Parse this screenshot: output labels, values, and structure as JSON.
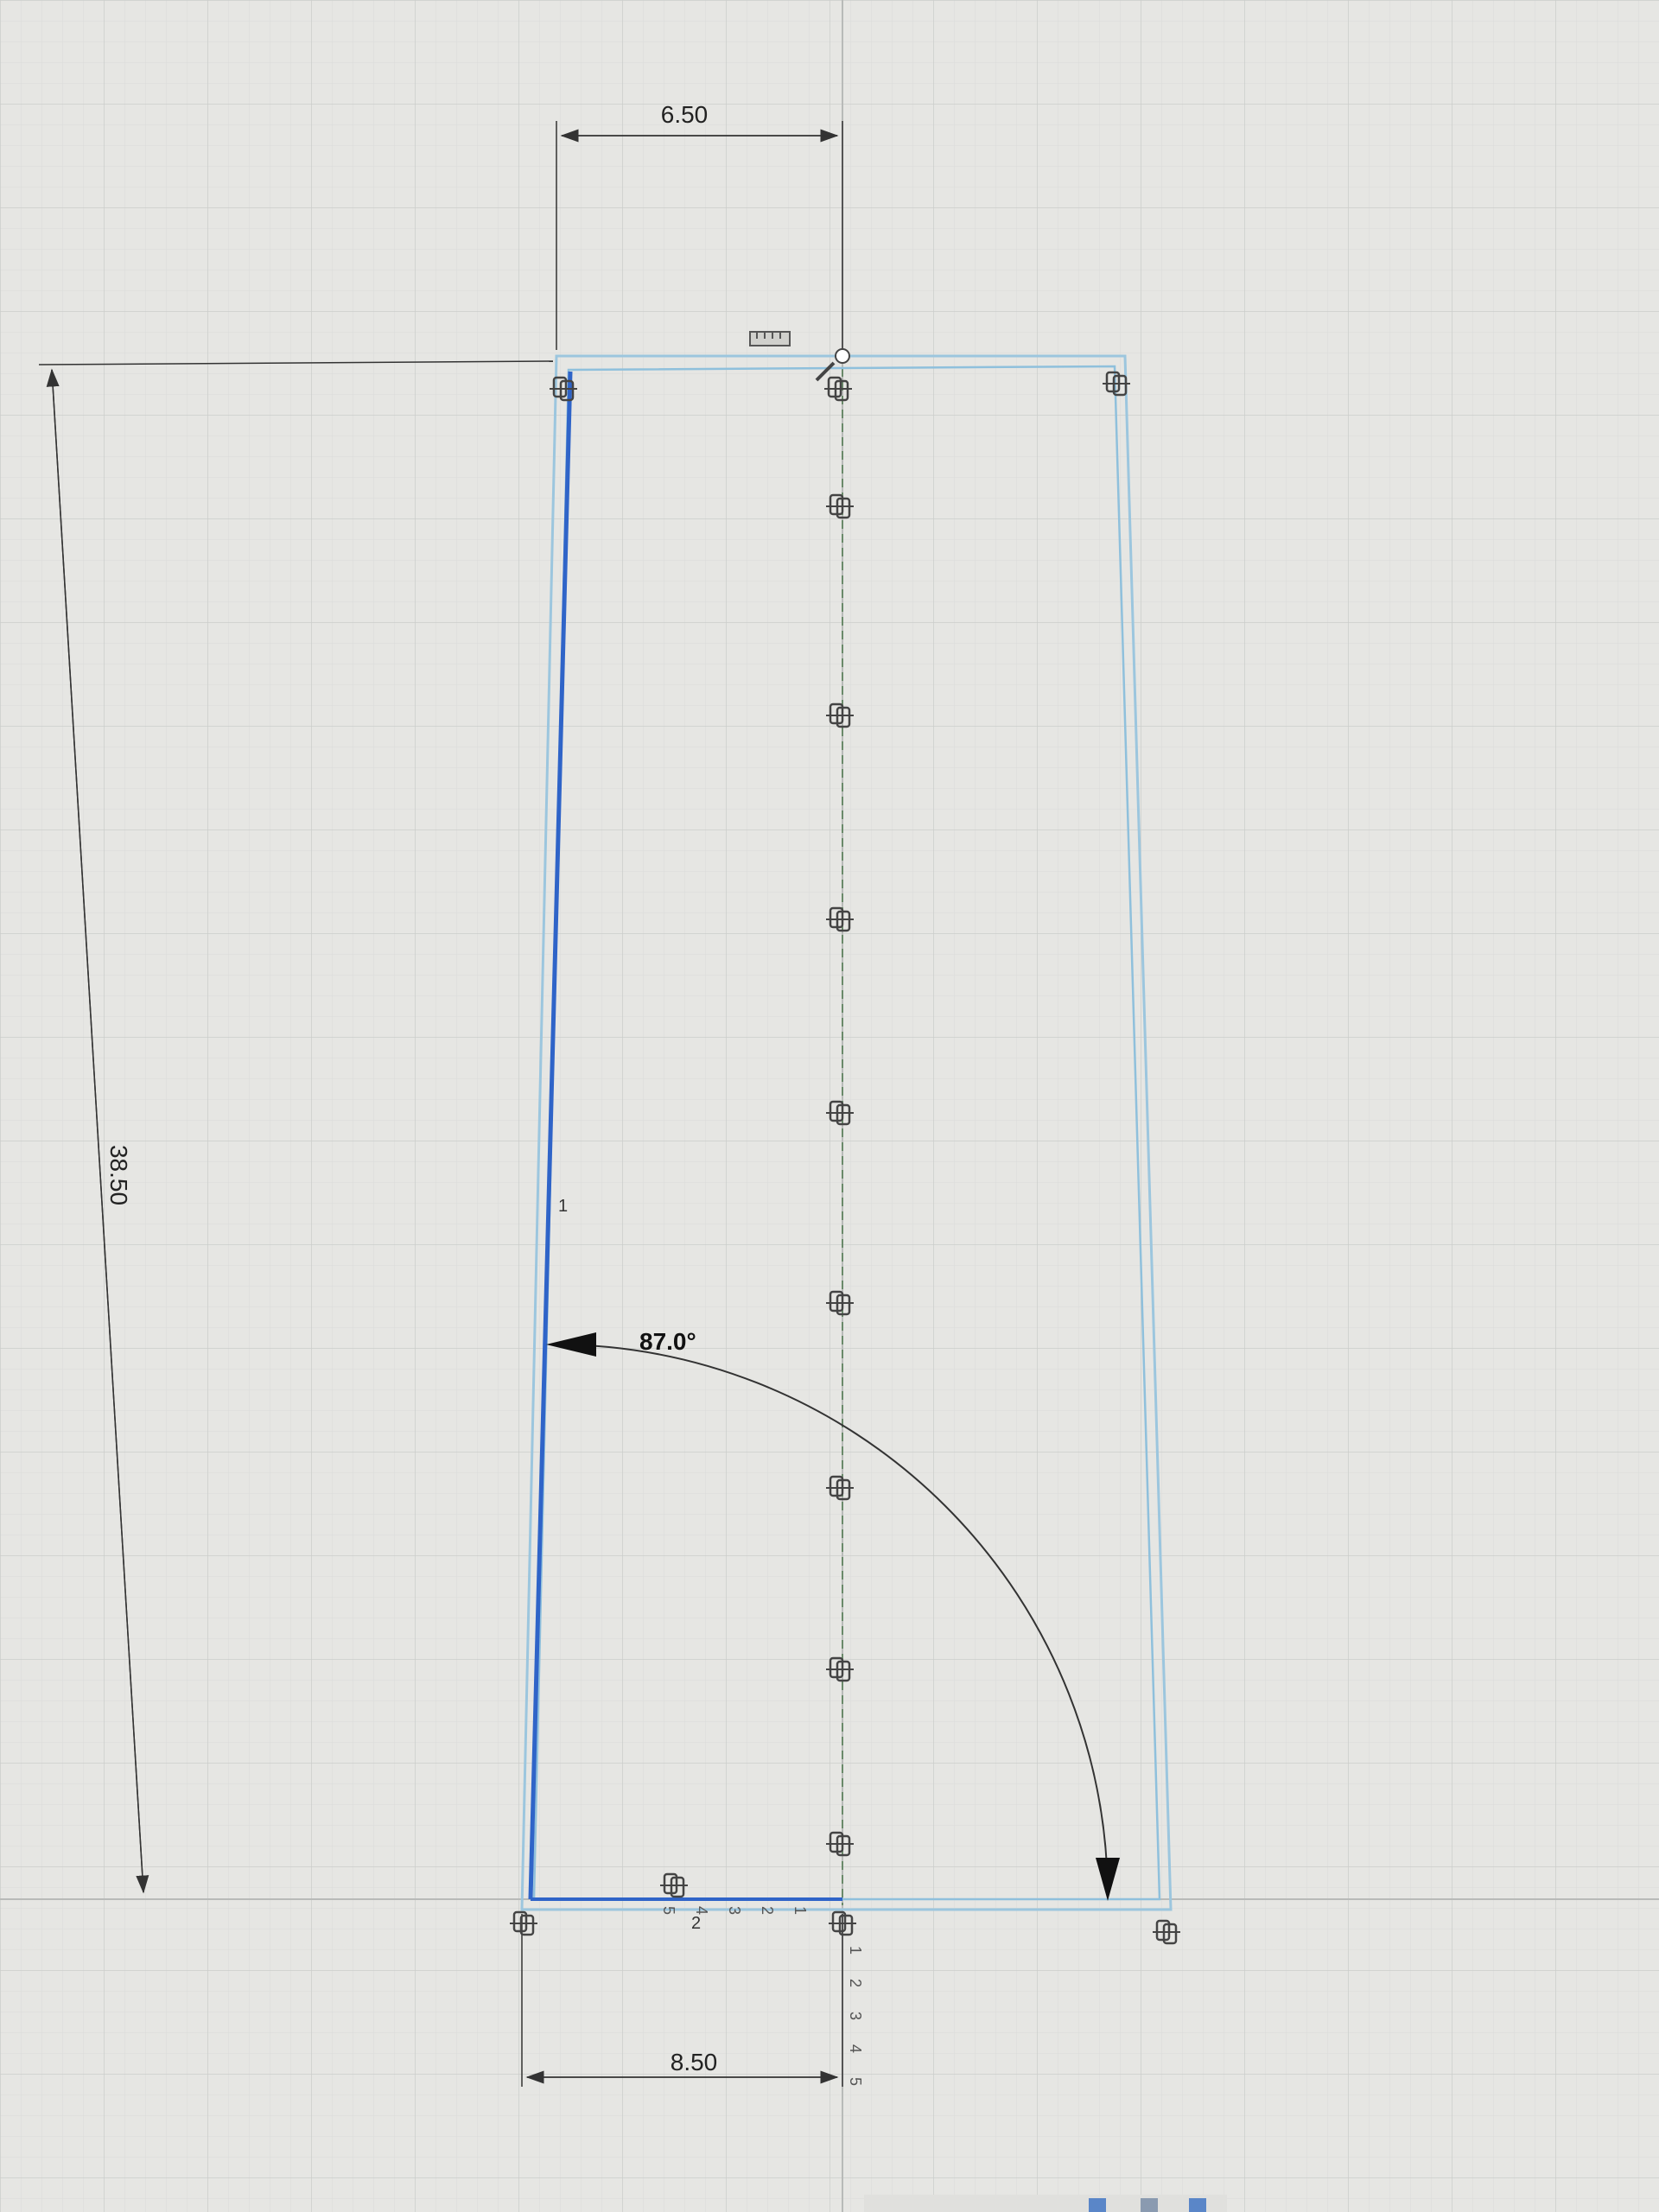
{
  "sketch": {
    "dimensions": {
      "top_width": "6.50",
      "height": "38.50",
      "bottom_width": "8.50",
      "angle": "87.0°"
    },
    "labels": {
      "left_line_index": "1",
      "origin_index": "2"
    },
    "axis_ticks_horizontal": [
      "1",
      "2",
      "3",
      "4",
      "5"
    ],
    "axis_ticks_vertical": [
      "1",
      "2",
      "3",
      "4",
      "5"
    ],
    "colors": {
      "background": "#e6e6e3",
      "grid_minor": "#d6d8d6",
      "grid_major": "#c8cac8",
      "profile_selected": "#2f64c8",
      "profile_light": "#8fc0dc",
      "dimension": "#333333",
      "centerline": "#6a8a6a"
    },
    "constraint_icon": "coincident-constraint-icon",
    "ruler_icon": "ruler-icon"
  }
}
